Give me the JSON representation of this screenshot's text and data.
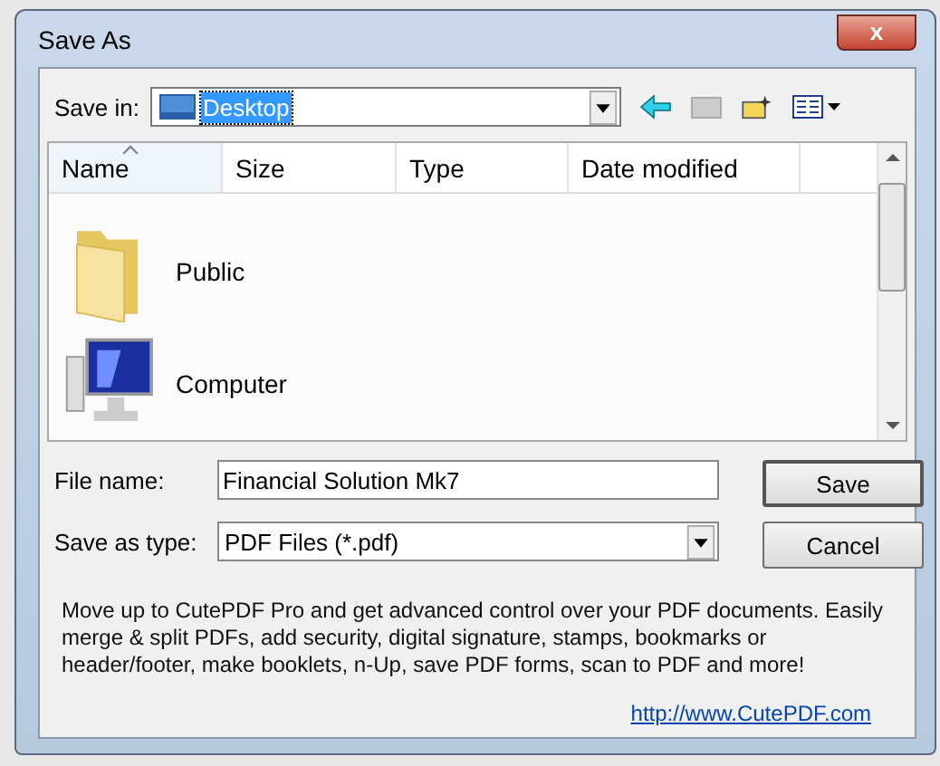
{
  "window": {
    "title": "Save As",
    "close": "x"
  },
  "save_in": {
    "label": "Save in:",
    "value": "Desktop"
  },
  "columns": [
    {
      "label": "Name",
      "sorted": true
    },
    {
      "label": "Size",
      "sorted": false
    },
    {
      "label": "Type",
      "sorted": false
    },
    {
      "label": "Date modified",
      "sorted": false
    }
  ],
  "items": [
    {
      "kind": "folder",
      "name": "Public"
    },
    {
      "kind": "computer",
      "name": "Computer"
    }
  ],
  "file_name": {
    "label": "File name:",
    "value": "Financial Solution Mk7"
  },
  "save_as_type": {
    "label": "Save as type:",
    "value": "PDF Files (*.pdf)"
  },
  "buttons": [
    "Save",
    "Cancel"
  ],
  "promo": "Move up to CutePDF Pro and get advanced control over your PDF documents. Easily merge & split PDFs, add security, digital signature, stamps, bookmarks or header/footer, make booklets, n-Up, save PDF forms, scan to PDF and more!",
  "link": "http://www.CutePDF.com"
}
